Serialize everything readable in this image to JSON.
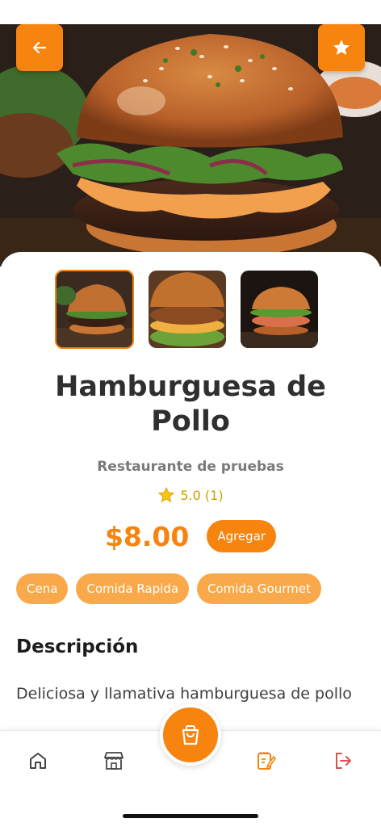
{
  "product": {
    "name": "Hamburguesa de Pollo",
    "restaurant": "Restaurante de pruebas",
    "rating": "5.0 (1)",
    "price": "$8.00",
    "add_label": "Agregar",
    "tags": [
      "Cena",
      "Comida Rapida",
      "Comida Gourmet"
    ],
    "description_title": "Descripción",
    "description": "Deliciosa y llamativa hamburguesa de pollo"
  },
  "header": {
    "back_icon": "arrow-left-icon",
    "favorite_icon": "star-icon"
  },
  "gallery": {
    "images": [
      "burger-photo-1",
      "burger-photo-2",
      "burger-photo-3"
    ],
    "selected_index": 0
  },
  "nav": {
    "items": [
      "home-icon",
      "store-icon",
      "cart-icon",
      "orders-icon",
      "logout-icon"
    ],
    "active": "orders-icon"
  },
  "colors": {
    "accent": "#f7840f",
    "tag": "#f9a94a",
    "star": "#f5c518",
    "logout": "#d9534f"
  }
}
